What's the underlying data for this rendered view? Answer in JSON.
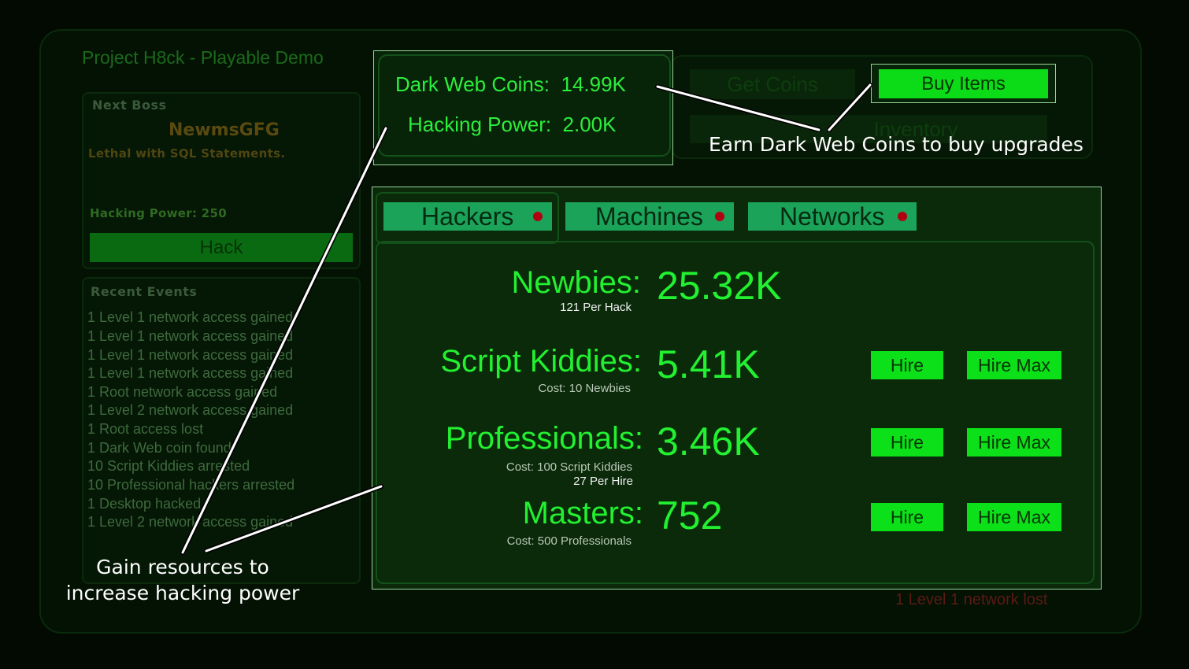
{
  "game": {
    "title": "Project H8ck - Playable Demo",
    "boss": {
      "heading": "Next Boss",
      "name": "NewmsGFG",
      "description": "Lethal with SQL Statements.",
      "hacking_power": "Hacking Power: 250",
      "hack_button": "Hack"
    },
    "events": {
      "heading": "Recent Events",
      "items": [
        "1 Level 1 network access gained",
        "1 Level 1 network access gained",
        "1 Level 1 network access gained",
        "1 Level 1 network access gained",
        "1 Root network access gained",
        "1 Level 2 network access gained",
        "1 Root access lost",
        "1 Dark Web coin found",
        "10 Script Kiddies arrested",
        "10 Professional hackers arrested",
        "1 Desktop hacked",
        "1 Level 2 network access gained"
      ]
    },
    "stats": {
      "coins_label": "Dark Web Coins:",
      "coins_value": "14.99K",
      "power_label": "Hacking Power:",
      "power_value": "2.00K"
    },
    "shop": {
      "get_coins": "Get Coins",
      "buy_items": "Buy Items",
      "inventory": "Inventory"
    },
    "tabs": [
      "Hackers",
      "Machines",
      "Networks"
    ],
    "resources": [
      {
        "name": "Newbies:",
        "value": "25.32K",
        "sub1": "121 Per Hack",
        "sub2": ""
      },
      {
        "name": "Script Kiddies:",
        "value": "5.41K",
        "sub1": "Cost: 10 Newbies",
        "sub2": ""
      },
      {
        "name": "Professionals:",
        "value": "3.46K",
        "sub1": "Cost: 100 Script Kiddies",
        "sub2": "27 Per Hire"
      },
      {
        "name": "Masters:",
        "value": "752",
        "sub1": "Cost: 500 Professionals",
        "sub2": ""
      }
    ],
    "hire_label": "Hire",
    "hire_max_label": "Hire Max",
    "lost_message": "1 Level 1 network lost"
  },
  "annotations": {
    "coins": "Earn Dark Web Coins to buy upgrades",
    "resources_line1": "Gain resources to",
    "resources_line2": "increase hacking power"
  },
  "colors": {
    "accent": "#22f030",
    "tab": "#1ba35a",
    "button": "#0ce018",
    "alert_dot": "#b00010",
    "background": "#020a02"
  }
}
